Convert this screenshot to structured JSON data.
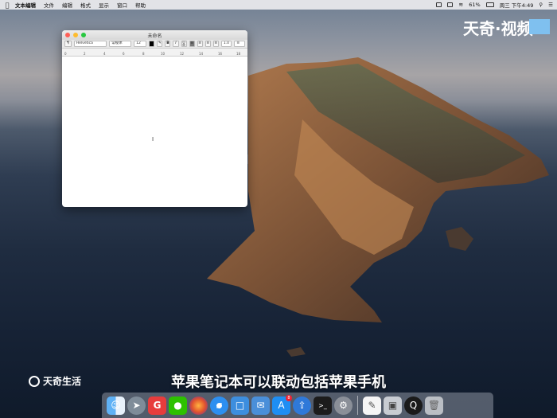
{
  "menubar": {
    "app_name": "文本编辑",
    "menus": [
      "文件",
      "编辑",
      "格式",
      "显示",
      "窗口",
      "帮助"
    ],
    "battery": "61%",
    "clock": "周三 下午4:49"
  },
  "window": {
    "title": "未命名",
    "font_family": "Helvetica",
    "font_style": "常规体",
    "font_size": "12",
    "spacing": "1.0",
    "ruler_marks": [
      "0",
      "2",
      "4",
      "6",
      "8",
      "10",
      "12",
      "14",
      "16",
      "18"
    ]
  },
  "overlay": {
    "watermark": "天奇·视频",
    "logo_text": "天奇生活",
    "subtitle": "苹果笔记本可以联动包括苹果手机"
  },
  "dock": {
    "items": [
      "finder-icon",
      "launchpad-icon",
      "app-g-icon",
      "wechat-icon",
      "firefox-icon",
      "safari-icon",
      "files-icon",
      "mail-icon",
      "app-store-icon",
      "upload-icon",
      "terminal-icon",
      "system-preferences-icon",
      "textedit-icon",
      "preview-icon",
      "quicktime-icon",
      "trash-icon"
    ],
    "app_store_badge": "8"
  },
  "colors": {
    "accent": "#7fc0ef",
    "close": "#fe5f57",
    "minimize": "#febc2e",
    "zoom": "#28c840"
  }
}
